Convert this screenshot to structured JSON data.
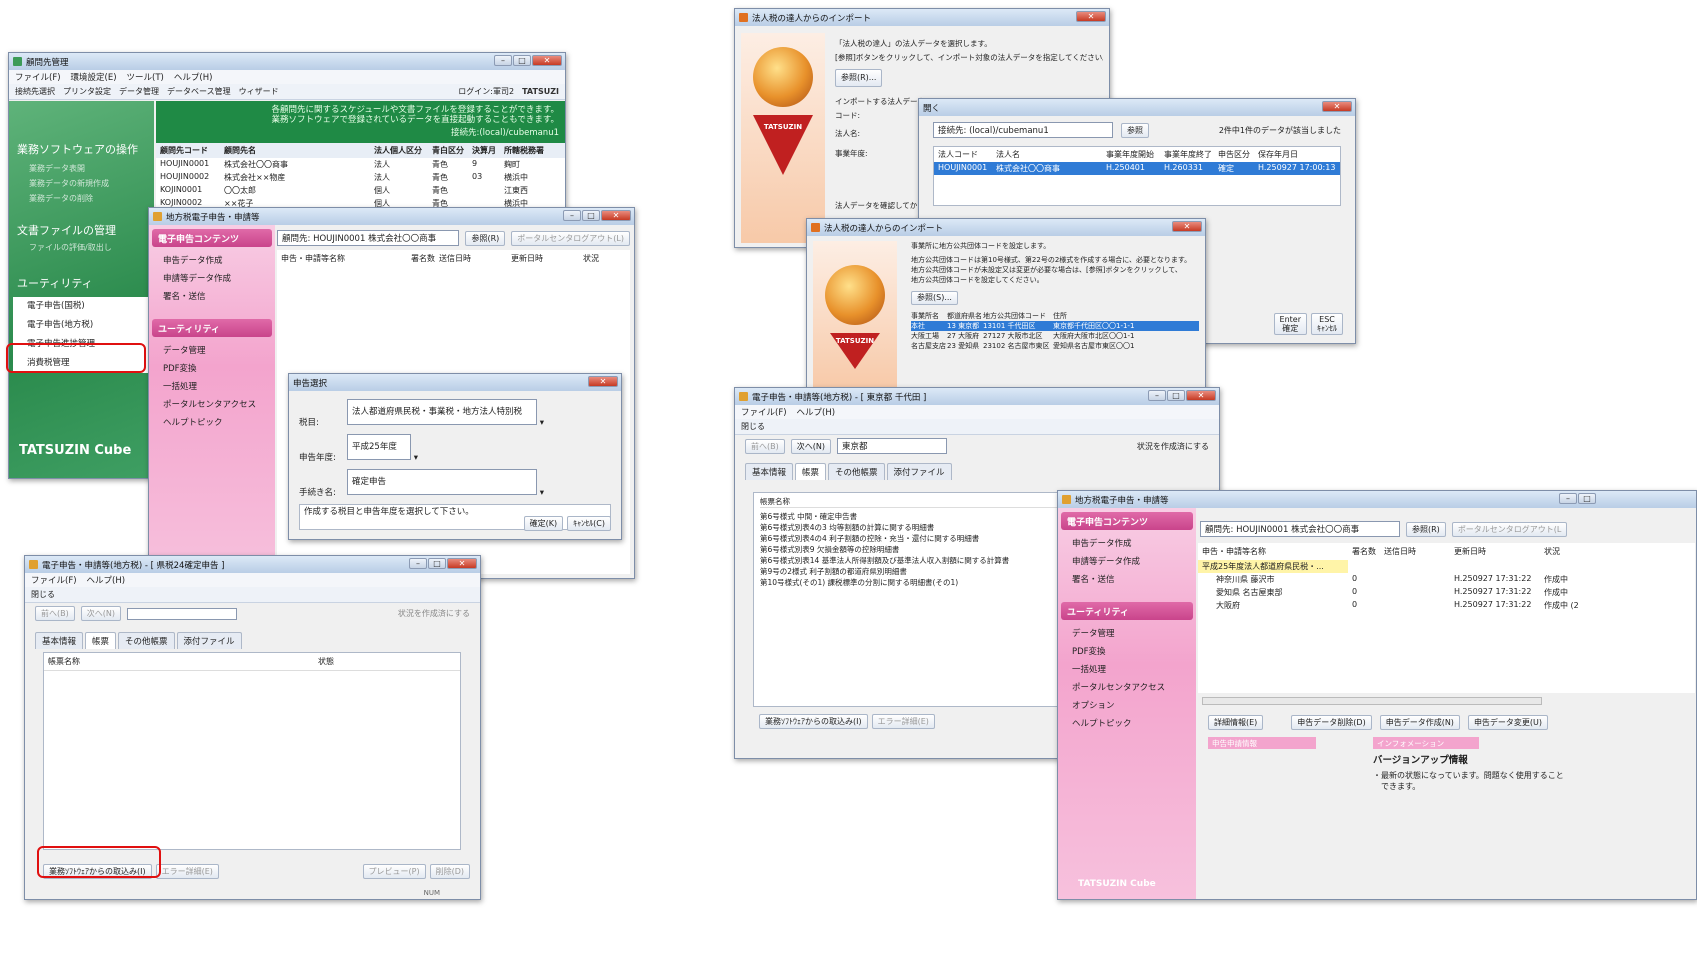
{
  "w1": {
    "title": "顧問先管理",
    "menu": [
      "ファイル(F)",
      "環境設定(E)",
      "ツール(T)",
      "ヘルプ(H)"
    ],
    "toolbar": [
      "接続先選択",
      "プリンタ設定",
      "データ管理",
      "データベース管理",
      "ウィザード"
    ],
    "login": "ログイン:軍司2",
    "brand": "TATSUZI",
    "banner1": "各顧問先に関するスケジュールや文書ファイルを登録することができます。",
    "banner2": "業務ソフトウェアで登録されているデータを直接起動することもできます。",
    "conn": "接続先:(local)/cubemanu1",
    "sec1": "業務ソフトウェアの操作",
    "sec1items": [
      "業務データ表開",
      "業務データの新規作成",
      "業務データの削除"
    ],
    "sec2": "文書ファイルの管理",
    "sec2items": [
      "ファイルの評価/取出し"
    ],
    "sec3": "ユーティリティ",
    "sec3items": [
      "電子申告(国税)",
      "電子申告(地方税)",
      "電子申告進捗管理",
      "消費税管理"
    ],
    "logo": "TATSUZIN Cube",
    "cols": [
      "顧問先コード",
      "顧問先名",
      "法人個人区分",
      "青白区分",
      "決算月",
      "所轄税務署"
    ],
    "rows": [
      [
        "HOUJIN0001",
        "株式会社〇〇商事",
        "法人",
        "青色",
        "9",
        "麹町"
      ],
      [
        "HOUJIN0002",
        "株式会社××物産",
        "法人",
        "青色",
        "03",
        "横浜中"
      ],
      [
        "KOJIN0001",
        "〇〇太郎",
        "個人",
        "青色",
        "",
        "江東西"
      ],
      [
        "KOJIN0002",
        "××花子",
        "個人",
        "青色",
        "",
        "横浜中"
      ]
    ]
  },
  "w2": {
    "title": "地方税電子申告・申請等",
    "pink1": "電子申告コンテンツ",
    "pitems1": [
      "申告データ作成",
      "申請等データ作成",
      "署名・送信"
    ],
    "pink2": "ユーティリティ",
    "pitems2": [
      "データ管理",
      "PDF変換",
      "一括処理",
      "ポータルセンタアクセス",
      "ヘルプトピック"
    ],
    "client": "顧問先: HOUJIN0001 株式会社〇〇商事",
    "ref": "参照(R)",
    "logout": "ポータルセンタログアウト(L)",
    "cols": [
      "申告・申請等名称",
      "署名数",
      "送信日時",
      "更新日時",
      "状況"
    ]
  },
  "w3": {
    "title": "申告選択",
    "l1": "税目:",
    "v1": "法人都道府県民税・事業税・地方法人特別税",
    "l2": "申告年度:",
    "v2": "平成25年度",
    "l3": "手続き名:",
    "v3": "確定申告",
    "msg": "作成する税目と申告年度を選択して下さい。",
    "ok": "確定(K)",
    "cancel": "ｷｬﾝｾﾙ(C)"
  },
  "w4": {
    "title": "電子申告・申請等(地方税) - [ 県税24確定申告 ]",
    "menu": [
      "ファイル(F)",
      "ヘルプ(H)"
    ],
    "close": "閉じる",
    "prev": "前へ(B)",
    "next": "次へ(N)",
    "chk": "状況を作成済にする",
    "tabs": [
      "基本情報",
      "帳票",
      "その他帳票",
      "添付ファイル"
    ],
    "col1": "帳票名称",
    "col2": "状態",
    "import": "業務ｿﾌﾄｳｪｱからの取込み(I)",
    "errdet": "エラー詳細(E)",
    "preview": "プレビュー(P)",
    "del": "削除(D)",
    "num": "NUM"
  },
  "w5": {
    "title": "法人税の達人からのインポート",
    "m1": "「法人税の達人」の法人データを選択します。",
    "m2": "[参照]ボタンをクリックして、インポート対象の法人データを指定してください。",
    "ref": "参照(R)...",
    "l1": "インポートする法人データ",
    "l2": "コード:",
    "l3": "法人名:",
    "l4": "事業年度:",
    "m3": "法人データを確認してから、[次へ]"
  },
  "w6": {
    "title": "開く",
    "conn": "接続先: (local)/cubemanu1",
    "ref": "参照",
    "cnt": "2件中1件のデータが該当しました",
    "cols": [
      "法人コード",
      "法人名",
      "事業年度開始",
      "事業年度終了",
      "申告区分",
      "保存年月日"
    ],
    "row": [
      "HOUJIN0001",
      "株式会社〇〇商事",
      "H.250401",
      "H.260331",
      "確定",
      "H.250927 17:00:13"
    ],
    "enter": "Enter",
    "ok": "確定",
    "esc": "ESC",
    "cancel": "ｷｬﾝｾﾙ"
  },
  "w7": {
    "title": "法人税の達人からのインポート",
    "m1": "事業所に地方公共団体コードを設定します。",
    "m2": "地方公共団体コードは第10号様式、第22号の2様式を作成する場合に、必要となります。",
    "m3": "地方公共団体コードが未設定又は変更が必要な場合は、[参照]ボタンをクリックして、",
    "m4": "地方公共団体コードを設定してください。",
    "ref": "参照(S)...",
    "cols": [
      "事業所名",
      "都道府県名",
      "地方公共団体コード",
      "住所"
    ],
    "rows": [
      [
        "本社",
        "13 東京都",
        "13101 千代田区",
        "東京都千代田区〇〇1-1-1"
      ],
      [
        "大阪工場",
        "27 大阪府",
        "27127 大阪市北区",
        "大阪府大阪市北区〇〇1-1"
      ],
      [
        "名古屋支店",
        "23 愛知県",
        "23102 名古屋市東区",
        "愛知県名古屋市東区〇〇1"
      ]
    ]
  },
  "w8": {
    "title": "電子申告・申請等(地方税) - [ 東京都 千代田 ]",
    "menu": [
      "ファイル(F)",
      "ヘルプ(H)"
    ],
    "close": "閉じる",
    "prev": "前へ(B)",
    "next": "次へ(N)",
    "pref": "東京都",
    "chk": "状況を作成済にする",
    "tabs": [
      "基本情報",
      "帳票",
      "その他帳票",
      "添付ファイル"
    ],
    "col1": "帳票名称",
    "forms": [
      "第6号様式 中間・確定申告書",
      "第6号様式別表4の3 均等割額の計算に関する明細書",
      "第6号様式別表4の4 利子割額の控除・充当・還付に関する明細書",
      "第6号様式別表9 欠損金額等の控除明細書",
      "第6号様式別表14 基準法人所得割額及び基準法人収入割額に関する計算書",
      "第9号の2様式 利子割額の都道府県別明細書",
      "第10号様式(その1) 課税標準の分割に関する明細書(その1)"
    ],
    "import": "業務ｿﾌﾄｳｪｱからの取込み(I)",
    "errdet": "エラー詳細(E)"
  },
  "w9": {
    "title": "地方税電子申告・申請等",
    "pink1": "電子申告コンテンツ",
    "pitems1": [
      "申告データ作成",
      "申請等データ作成",
      "署名・送信"
    ],
    "pink2": "ユーティリティ",
    "pitems2": [
      "データ管理",
      "PDF変換",
      "一括処理",
      "ポータルセンタアクセス",
      "オプション",
      "ヘルプトピック"
    ],
    "client": "顧問先: HOUJIN0001 株式会社〇〇商事",
    "ref": "参照(R)",
    "logout": "ポータルセンタログアウト(L",
    "cols": [
      "申告・申請等名称",
      "署名数",
      "送信日時",
      "更新日時",
      "状況"
    ],
    "group": "平成25年度法人都道府県民税・...",
    "rows": [
      [
        "神奈川県 藤沢市",
        "0",
        "",
        "H.250927 17:31:22",
        "作成中"
      ],
      [
        "愛知県 名古屋東部",
        "0",
        "",
        "H.250927 17:31:22",
        "作成中"
      ],
      [
        "大阪府",
        "0",
        "",
        "H.250927 17:31:22",
        "作成中 (2"
      ]
    ],
    "btns": [
      "詳細情報(E)",
      "申告データ削除(D)",
      "申告データ作成(N)",
      "申告データ変更(U)"
    ],
    "tabA": "申告申請情報",
    "tabB": "インフォメーション",
    "info_title": "バージョンアップ情報",
    "info1": "・最新の状態になっています。問題なく使用すること",
    "info2": "できます。",
    "logo": "TATSUZIN Cube"
  }
}
